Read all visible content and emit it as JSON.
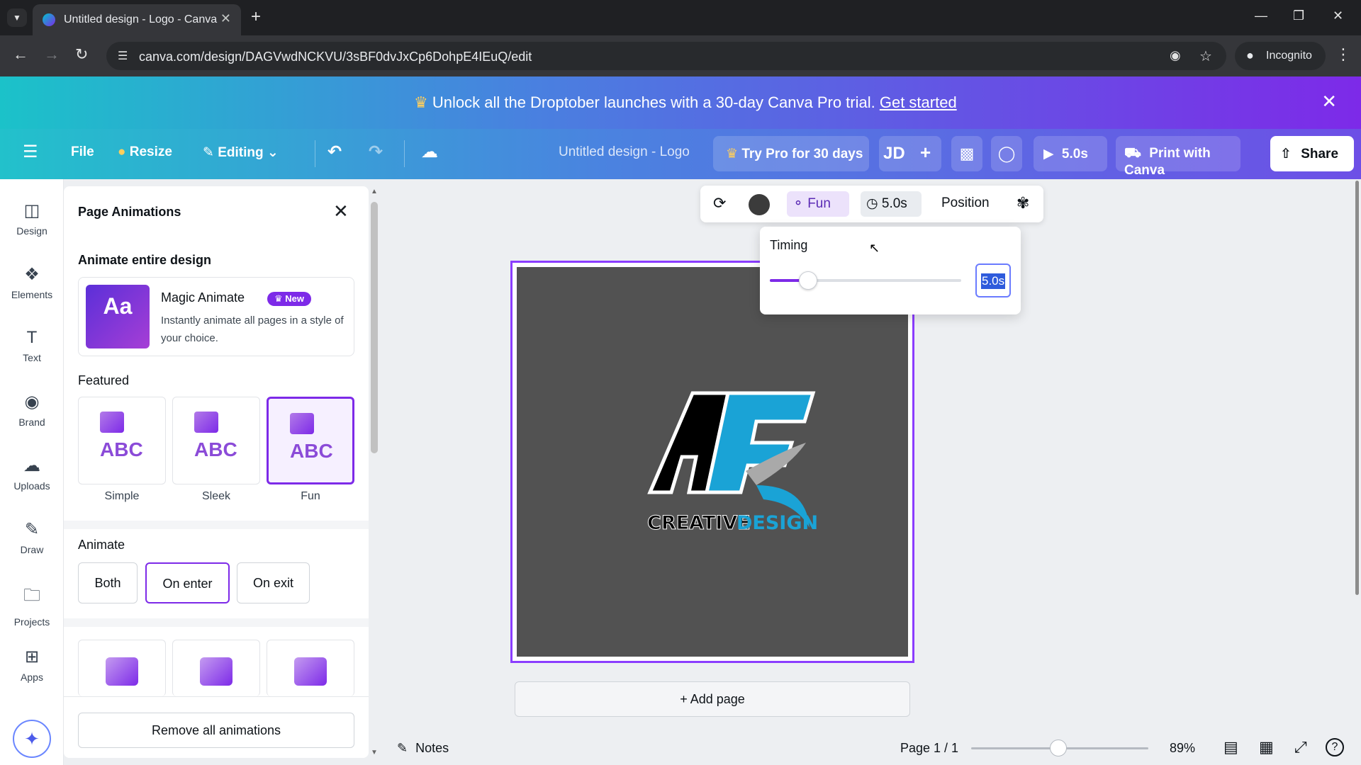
{
  "browser": {
    "tab_title": "Untitled design - Logo - Canva",
    "url": "canva.com/design/DAGVwdNCKVU/3sBF0dvJxCp6DohpE4IEuQ/edit",
    "incognito_label": "Incognito"
  },
  "banner": {
    "message": "Unlock all the Droptober launches with a 30-day Canva Pro trial.",
    "link": "Get started"
  },
  "header": {
    "file": "File",
    "resize": "Resize",
    "editing": "Editing",
    "design_title": "Untitled design - Logo",
    "try_pro": "Try Pro for 30 days",
    "avatar": "JD",
    "play_duration": "5.0s",
    "print": "Print with Canva",
    "share": "Share"
  },
  "rail": [
    {
      "label": "Design",
      "icon": "design-icon"
    },
    {
      "label": "Elements",
      "icon": "elements-icon"
    },
    {
      "label": "Text",
      "icon": "text-icon"
    },
    {
      "label": "Brand",
      "icon": "brand-icon"
    },
    {
      "label": "Uploads",
      "icon": "uploads-icon"
    },
    {
      "label": "Draw",
      "icon": "draw-icon"
    },
    {
      "label": "Projects",
      "icon": "projects-icon"
    },
    {
      "label": "Apps",
      "icon": "apps-icon"
    }
  ],
  "panel": {
    "title": "Page Animations",
    "animate_entire": "Animate entire design",
    "magic": {
      "name": "Magic Animate",
      "badge": "New",
      "description": "Instantly animate all pages in a style of your choice."
    },
    "featured": "Featured",
    "animations": [
      {
        "label": "Simple",
        "selected": false
      },
      {
        "label": "Sleek",
        "selected": false
      },
      {
        "label": "Fun",
        "selected": true
      }
    ],
    "animate_heading": "Animate",
    "animate_options": [
      {
        "label": "Both",
        "selected": false
      },
      {
        "label": "On enter",
        "selected": true
      },
      {
        "label": "On exit",
        "selected": false
      }
    ],
    "remove_all": "Remove all animations"
  },
  "toolbar": {
    "animation": "Fun",
    "duration": "5.0s",
    "position": "Position"
  },
  "timing": {
    "title": "Timing",
    "value": "5.0s",
    "slider_fraction": 0.15
  },
  "logo": {
    "letters": "AF",
    "word1": "CREATIVE",
    "word2": "DESIGN"
  },
  "canvas": {
    "add_page": "+ Add page"
  },
  "footer": {
    "notes": "Notes",
    "page_indicator": "Page 1 / 1",
    "zoom": "89%",
    "zoom_fraction": 0.49
  },
  "colors": {
    "accent": "#7d2ae8",
    "logo_blue": "#1aa3d6",
    "canvas_bg": "#525252"
  }
}
